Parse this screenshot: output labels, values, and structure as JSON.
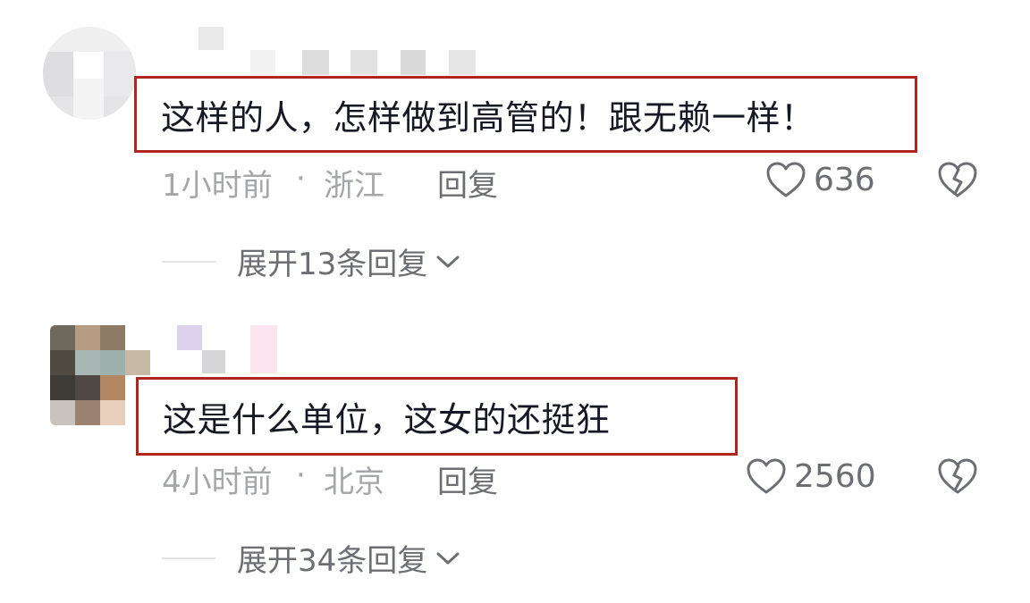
{
  "comments": [
    {
      "text": "这样的人，怎样做到高管的！跟无赖一样！",
      "time": "1小时前",
      "separator": "·",
      "location": "浙江",
      "reply_label": "回复",
      "like_count": "636",
      "expand_label": "展开13条回复"
    },
    {
      "text": "这是什么单位，这女的还挺狂",
      "time": "4小时前",
      "separator": "·",
      "location": "北京",
      "reply_label": "回复",
      "like_count": "2560",
      "expand_label": "展开34条回复"
    }
  ],
  "icons": {
    "like": "heart-outline-icon",
    "dislike": "broken-heart-icon",
    "expand": "chevron-down-icon"
  },
  "colors": {
    "highlight_border": "#b0261f",
    "meta_text": "#a5a6aa",
    "action_text": "#6d6e73"
  }
}
